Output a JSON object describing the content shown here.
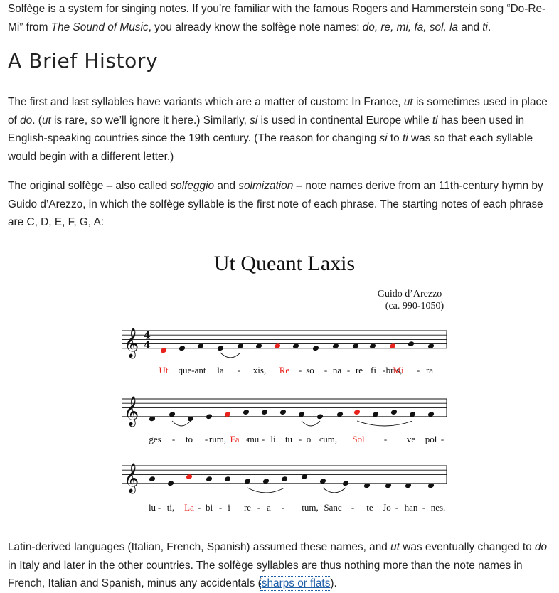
{
  "intro": {
    "t1": "Solfège is a system for singing notes. If you’re familiar with the famous Rogers and Hammerstein song “Do-Re-Mi” from ",
    "film": "The Sound of Music",
    "t2": ", you already know the solfège note names: ",
    "names": "do, re, mi, fa, sol, la",
    "t3": " and ",
    "last": "ti",
    "t4": "."
  },
  "history_heading": "A Brief History",
  "para1": {
    "t1": "The first and last syllables have variants which are a matter of custom: In France, ",
    "ut": "ut",
    "t2": " is sometimes used in place of ",
    "do": "do",
    "t3": ". (",
    "ut2": "ut",
    "t4": " is rare, so we’ll ignore it here.) Similarly, ",
    "si": "si",
    "t5": " is used in continental Europe while ",
    "ti": "ti",
    "t6": " has been used in English-speaking countries since the 19th century. (The reason for changing ",
    "si2": "si",
    "t7": " to ",
    "ti2": "ti",
    "t8": " was so that each syllable would begin with a different letter.)"
  },
  "para2": {
    "t1": "The original solfège – also called ",
    "solfeggio": "solfeggio",
    "t2": " and ",
    "solmization": "solmization",
    "t3": " – note names derive from an 11th-century hymn by Guido d’Arezzo, in which the solfège syllable is the first note of each phrase. The starting notes of each phrase are C, D, E, F, G, A:"
  },
  "score": {
    "title": "Ut Queant Laxis",
    "composer": "Guido d’Arezzo",
    "dates": "(ca. 990-1050)",
    "time_signature": [
      "4",
      "4"
    ],
    "lyrics": [
      [
        "Ut",
        "que-ant",
        "la",
        "-",
        "xis,",
        "Re",
        "-",
        "so",
        "-",
        "na",
        "-",
        "re",
        "fi",
        "-",
        "bris,",
        "Mi",
        "-",
        "ra"
      ],
      [
        "ges",
        "-",
        "to",
        "-",
        "rum,",
        "Fa",
        "-",
        "mu",
        "-",
        "li",
        "tu",
        "-",
        "o",
        "-",
        "rum,",
        "Sol",
        "-",
        "ve",
        "pol",
        "-"
      ],
      [
        "lu",
        "-",
        "ti,",
        "La",
        "-",
        "bi",
        "-",
        "i",
        "re",
        "-",
        "a",
        "-",
        "tum,",
        "Sanc",
        "-",
        "te",
        "Jo",
        "-",
        "han",
        "-",
        "nes."
      ]
    ],
    "colors": {
      "highlight": "#e8231e",
      "ink": "#111111"
    }
  },
  "para3": {
    "t1": "Latin-derived languages (Italian, French, Spanish) assumed these names, and ",
    "ut": "ut",
    "t2": " was eventually changed to ",
    "do": "do",
    "t3": " in Italy and later in the other countries. The solfège syllables are thus nothing more than the note names in French, Italian and Spanish, minus any accidentals (",
    "link": "sharps or flats",
    "t4": ")."
  }
}
